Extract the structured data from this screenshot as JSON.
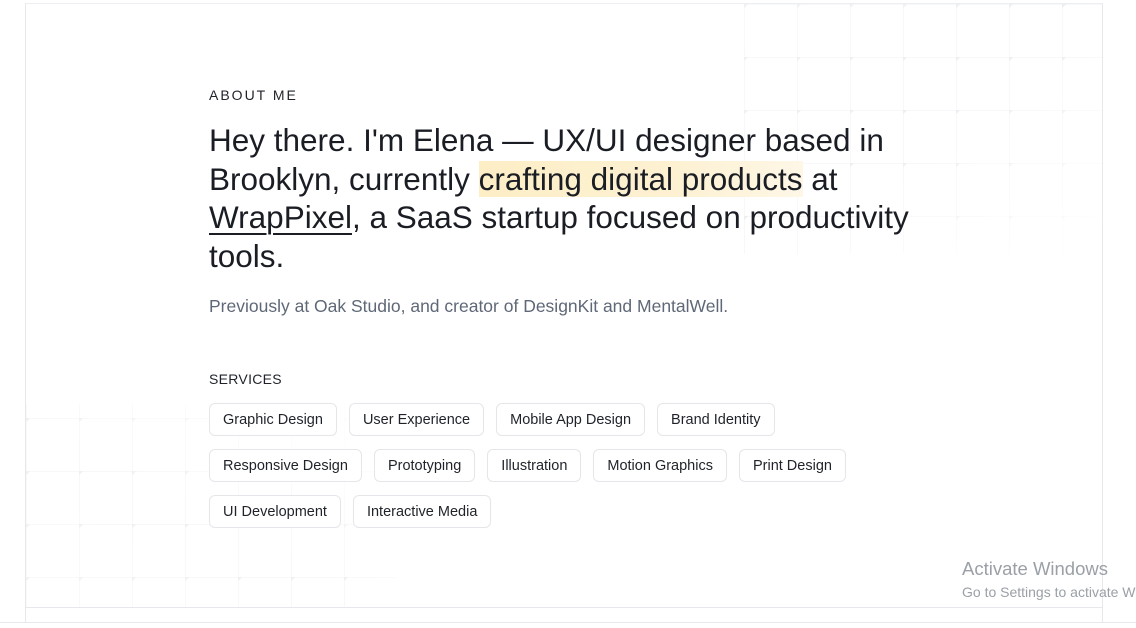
{
  "about": {
    "eyebrow": "ABOUT ME",
    "headline": {
      "part1": "Hey there. I'm Elena — UX/UI designer based in Brooklyn, currently ",
      "highlight": "crafting digital products",
      "part2": " at ",
      "company": "WrapPixel",
      "part3": ", a SaaS startup focused on productivity tools."
    },
    "subline": "Previously at Oak Studio, and creator of DesignKit and MentalWell."
  },
  "services": {
    "title": "SERVICES",
    "items": [
      "Graphic Design",
      "User Experience",
      "Mobile App Design",
      "Brand Identity",
      "Responsive Design",
      "Prototyping",
      "Illustration",
      "Motion Graphics",
      "Print Design",
      "UI Development",
      "Interactive Media"
    ]
  },
  "colors": {
    "highlight": "#fdeec6",
    "text": "#1a1d23",
    "muted": "#5f6877",
    "border": "#e4e6ea"
  },
  "watermark": {
    "title": "Activate Windows",
    "subtitle": "Go to Settings to activate Windows."
  }
}
